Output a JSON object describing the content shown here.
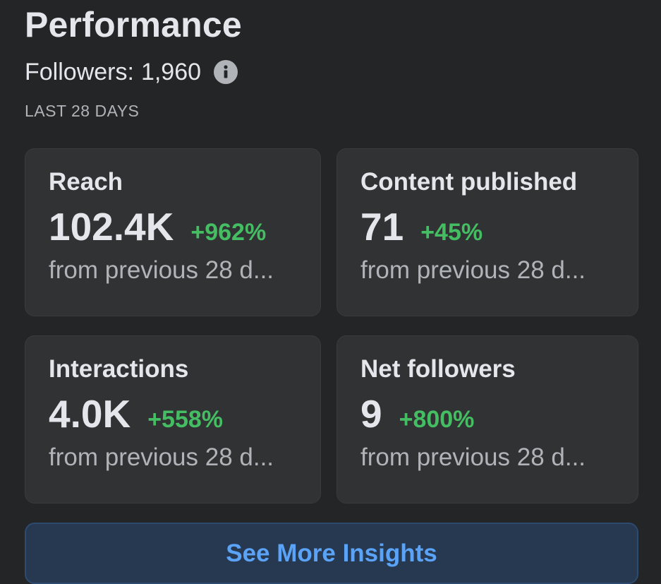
{
  "header": {
    "title": "Performance",
    "followers_label": "Followers:",
    "followers_value": "1,960",
    "info_icon": "info-icon",
    "period": "LAST 28 DAYS"
  },
  "cards": [
    {
      "label": "Reach",
      "value": "102.4K",
      "change": "+962%",
      "sub": "from previous 28 d..."
    },
    {
      "label": "Content published",
      "value": "71",
      "change": "+45%",
      "sub": "from previous 28 d..."
    },
    {
      "label": "Interactions",
      "value": "4.0K",
      "change": "+558%",
      "sub": "from previous 28 d..."
    },
    {
      "label": "Net followers",
      "value": "9",
      "change": "+800%",
      "sub": "from previous 28 d..."
    }
  ],
  "actions": {
    "see_more_label": "See More Insights"
  },
  "colors": {
    "background": "#242526",
    "card": "#303233",
    "positive": "#45bd62",
    "link": "#5aa3f7",
    "button_bg": "#263951"
  }
}
